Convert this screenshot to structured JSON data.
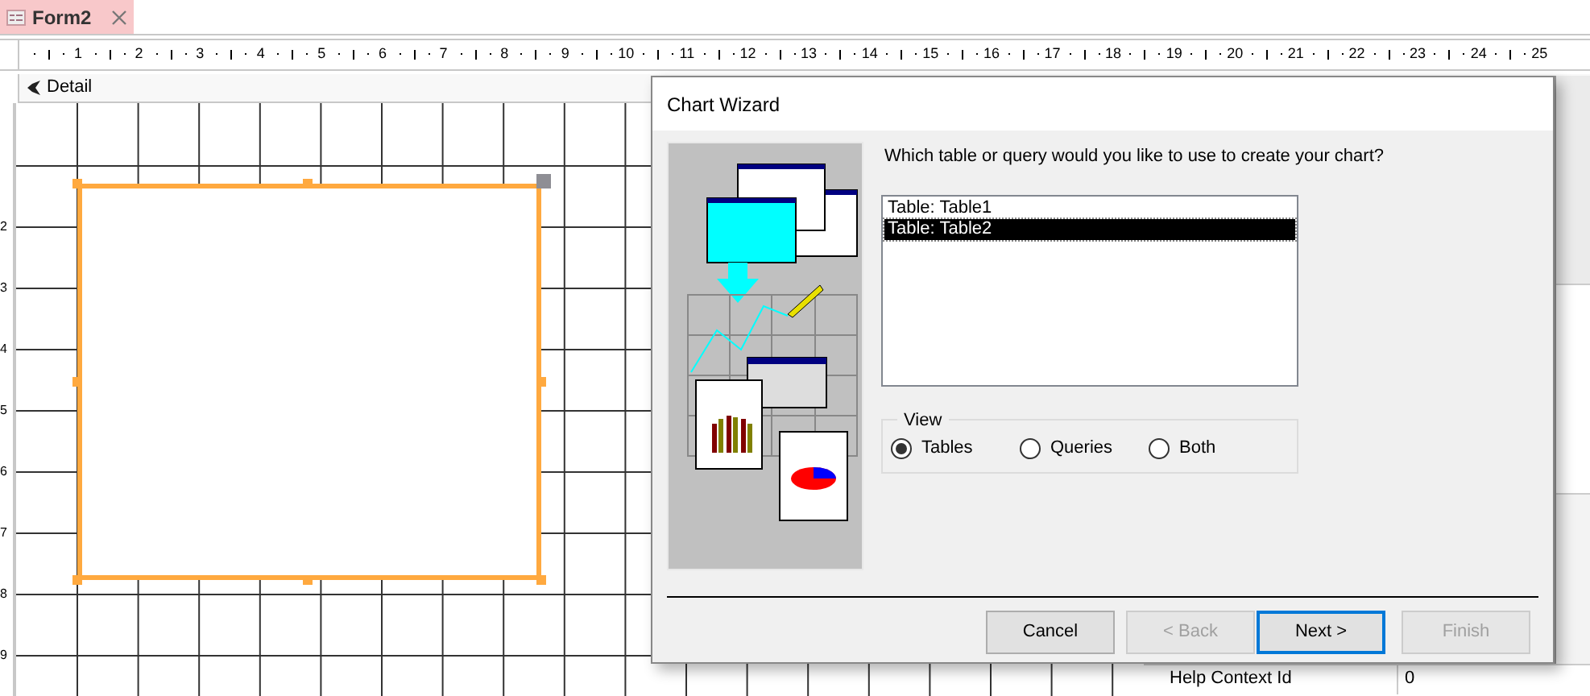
{
  "tab": {
    "title": "Form2",
    "selected": true
  },
  "ruler": {
    "marks": [
      "1",
      "2",
      "3",
      "4",
      "5",
      "6",
      "7",
      "8",
      "9",
      "10",
      "11",
      "12",
      "13",
      "14",
      "15",
      "16",
      "17",
      "18",
      "19",
      "20",
      "21",
      "22",
      "23",
      "24",
      "25"
    ]
  },
  "vertical_ruler": {
    "marks": [
      "2",
      "3",
      "4",
      "5",
      "6",
      "7",
      "8",
      "9"
    ]
  },
  "section": {
    "title": "Detail"
  },
  "dialog": {
    "title": "Chart Wizard",
    "prompt": "Which table or query would you like to use to create your chart?",
    "list": [
      {
        "label": "Table: Table1",
        "selected": false
      },
      {
        "label": "Table: Table2",
        "selected": true
      }
    ],
    "view": {
      "title": "View",
      "options": [
        {
          "label": "Tables",
          "selected": true
        },
        {
          "label": "Queries",
          "selected": false
        },
        {
          "label": "Both",
          "selected": false
        }
      ]
    },
    "buttons": [
      {
        "label": "Cancel",
        "disabled": false,
        "default": false
      },
      {
        "label": "< Back",
        "disabled": true,
        "default": false
      },
      {
        "label": "Next >",
        "disabled": false,
        "default": true
      },
      {
        "label": "Finish",
        "disabled": true,
        "default": false
      }
    ]
  },
  "property_sheet": {
    "rows": [
      {
        "name": "Help Context Id",
        "value": "0"
      }
    ]
  }
}
